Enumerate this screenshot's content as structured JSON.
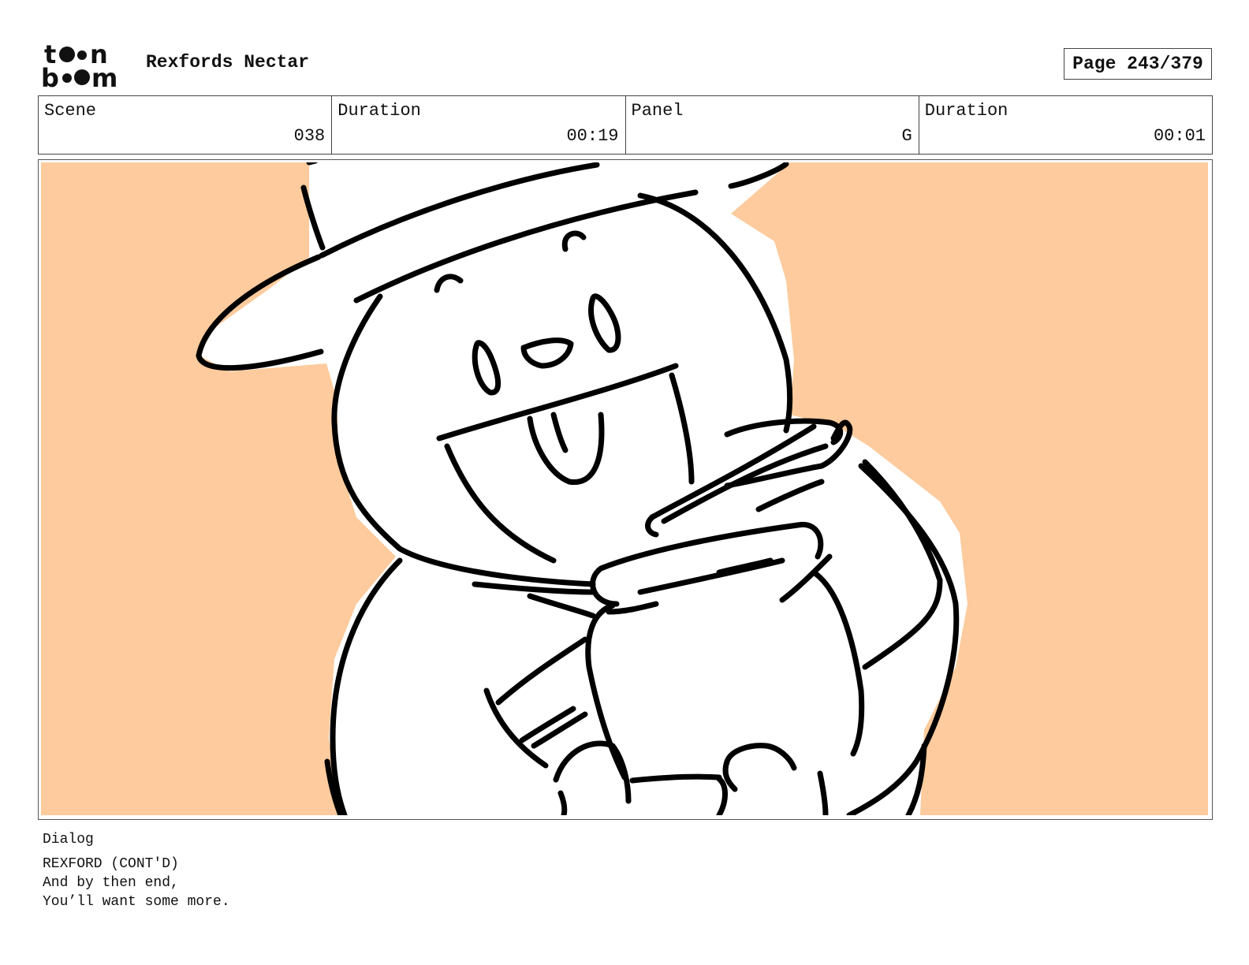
{
  "header": {
    "logo_text": "toon boom",
    "project_title": "Rexfords Nectar",
    "page_label": "Page 243/379"
  },
  "info": {
    "scene_label": "Scene",
    "scene_value": "038",
    "scene_duration_label": "Duration",
    "scene_duration_value": "00:19",
    "panel_label": "Panel",
    "panel_value": "G",
    "panel_duration_label": "Duration",
    "panel_duration_value": "00:01"
  },
  "panel": {
    "background_color": "#FDCB9D",
    "line_color": "#000000"
  },
  "dialog": {
    "label": "Dialog",
    "lines": [
      "REXFORD (CONT'D)",
      "And by then end,",
      "You’ll want some more."
    ]
  }
}
